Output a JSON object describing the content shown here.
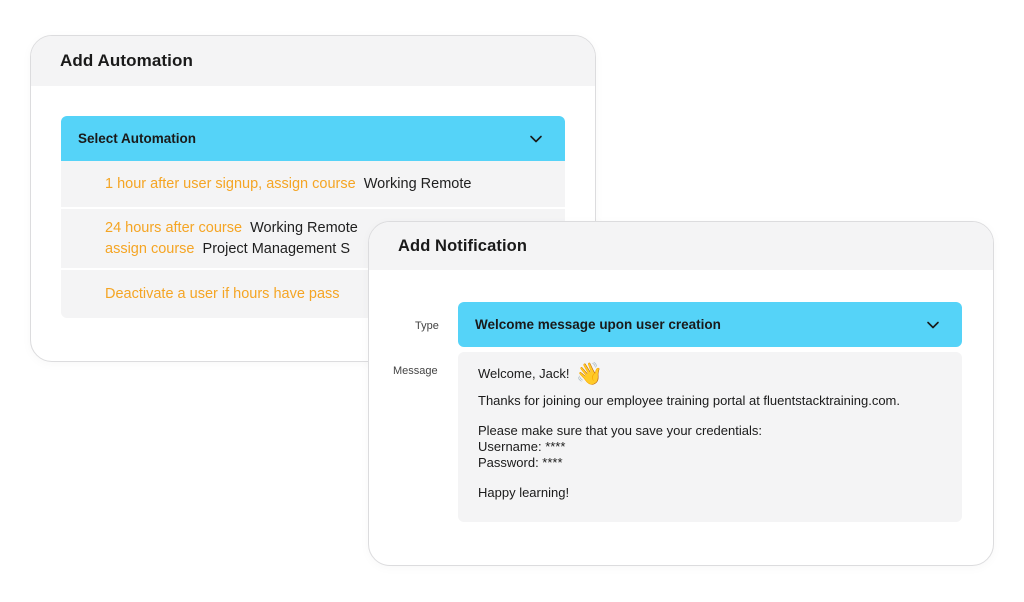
{
  "automation": {
    "title": "Add Automation",
    "select_label": "Select Automation",
    "items": [
      {
        "lines": [
          {
            "trigger": "1 hour after user signup, assign course",
            "target": "Working Remote"
          }
        ]
      },
      {
        "lines": [
          {
            "trigger": "24 hours after course",
            "target": "Working Remote"
          },
          {
            "trigger": "assign course",
            "target": "Project Management S"
          }
        ]
      },
      {
        "lines": [
          {
            "trigger": "Deactivate a user if hours have pass",
            "target": ""
          }
        ]
      }
    ]
  },
  "notification": {
    "title": "Add Notification",
    "type_label": "Type",
    "type_value": "Welcome message upon user creation",
    "message_label": "Message",
    "message": {
      "greeting": "Welcome, Jack!",
      "greeting_icon": "waving-hand-icon",
      "body1": "Thanks for joining our employee training portal at fluentstacktraining.com.",
      "body2": "Please make sure that you save your credentials:",
      "username": "Username: ****",
      "password": "Password: ****",
      "closing": "Happy learning!"
    }
  },
  "colors": {
    "accent": "#55d3f8",
    "trigger_text": "#f5a524",
    "panel_bg": "#f4f4f5"
  }
}
